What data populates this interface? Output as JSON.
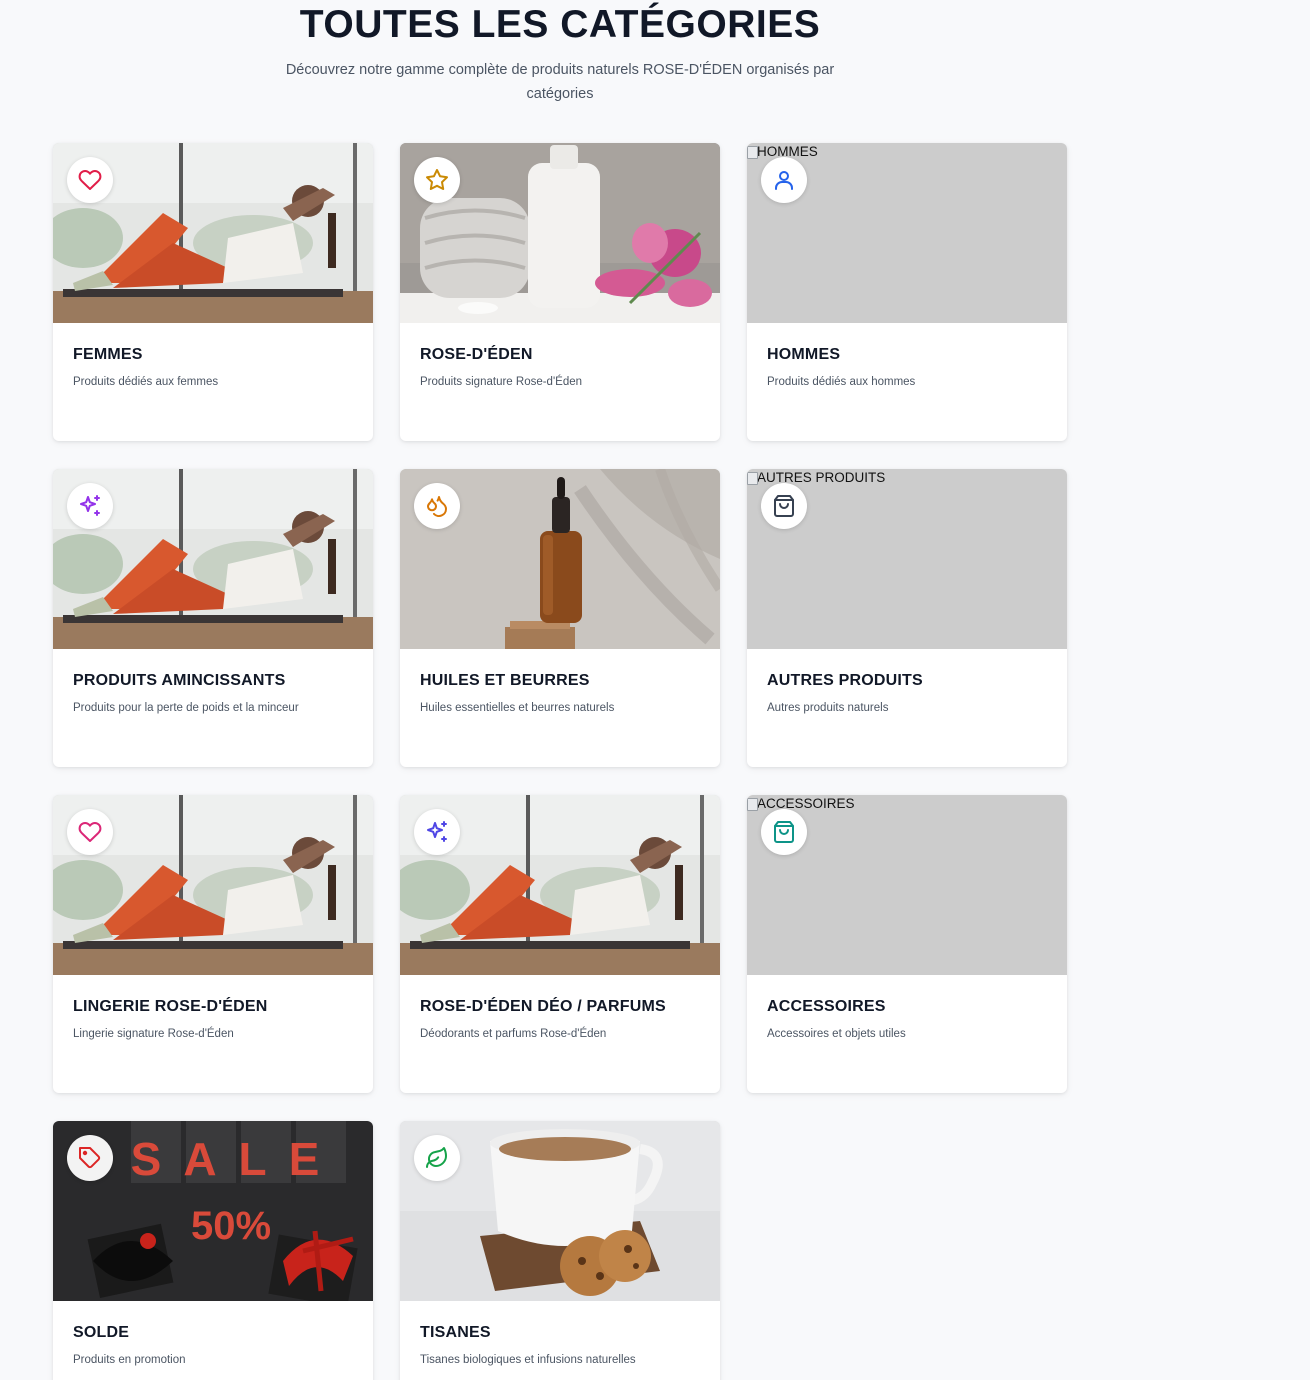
{
  "header": {
    "title": "TOUTES LES CATÉGORIES",
    "subtitle": "Découvrez notre gamme complète de produits naturels ROSE-D'ÉDEN organisés par catégories"
  },
  "categories": [
    {
      "title": "FEMMES",
      "description": "Produits dédiés aux femmes",
      "icon": "heart-icon",
      "icon_color": "#e11d48"
    },
    {
      "title": "ROSE-D'ÉDEN",
      "description": "Produits signature Rose-d'Éden",
      "icon": "star-icon",
      "icon_color": "#ca8a04"
    },
    {
      "title": "HOMMES",
      "description": "Produits dédiés aux hommes",
      "icon": "user-icon",
      "icon_color": "#2563eb",
      "image_alt": "HOMMES"
    },
    {
      "title": "PRODUITS AMINCISSANTS",
      "description": "Produits pour la perte de poids et la minceur",
      "icon": "sparkles-icon",
      "icon_color": "#9333ea"
    },
    {
      "title": "HUILES ET BEURRES",
      "description": "Huiles essentielles et beurres naturels",
      "icon": "droplets-icon",
      "icon_color": "#d97706"
    },
    {
      "title": "AUTRES PRODUITS",
      "description": "Autres produits naturels",
      "icon": "shopping-bag-icon",
      "icon_color": "#374151",
      "image_alt": "AUTRES PRODUITS"
    },
    {
      "title": "LINGERIE ROSE-D'ÉDEN",
      "description": "Lingerie signature Rose-d'Éden",
      "icon": "heart-icon",
      "icon_color": "#db2777"
    },
    {
      "title": "ROSE-D'ÉDEN DÉO / PARFUMS",
      "description": "Déodorants et parfums Rose-d'Éden",
      "icon": "sparkles-icon",
      "icon_color": "#4f46e5"
    },
    {
      "title": "ACCESSOIRES",
      "description": "Accessoires et objets utiles",
      "icon": "shopping-bag-icon",
      "icon_color": "#0d9488",
      "image_alt": "ACCESSOIRES"
    },
    {
      "title": "SOLDE",
      "description": "Produits en promotion",
      "icon": "tag-icon",
      "icon_color": "#dc2626",
      "sale_text": "SALE",
      "discount_text": "50%"
    },
    {
      "title": "TISANES",
      "description": "Tisanes biologiques et infusions naturelles",
      "icon": "leaf-icon",
      "icon_color": "#16a34a"
    }
  ]
}
